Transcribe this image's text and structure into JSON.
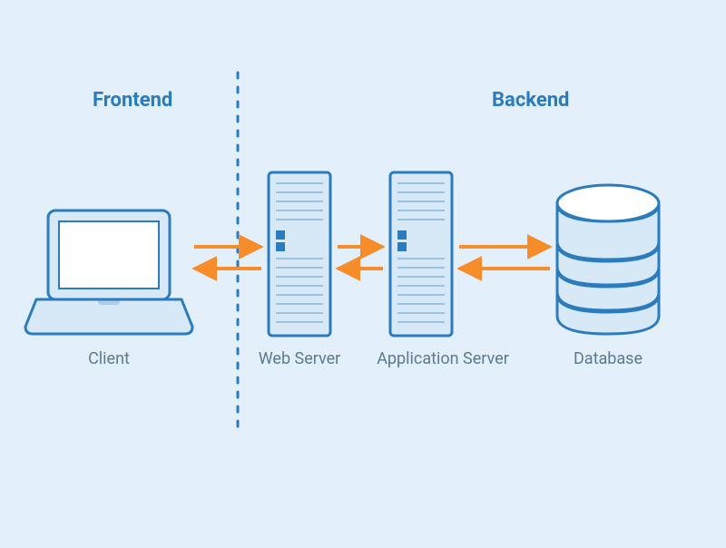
{
  "sections": {
    "frontend": "Frontend",
    "backend": "Backend"
  },
  "nodes": {
    "client": {
      "label": "Client"
    },
    "web": {
      "label": "Web Server"
    },
    "app": {
      "label": "Application Server"
    },
    "database": {
      "label": "Database"
    }
  },
  "colors": {
    "stroke": "#2b7bbf",
    "fill_light": "#d7e9f7",
    "fill_white": "#ffffff",
    "arrow": "#f78c2a",
    "label": "#5a7a92"
  },
  "connections": [
    {
      "from": "client",
      "to": "web",
      "bidirectional": true
    },
    {
      "from": "web",
      "to": "app",
      "bidirectional": true
    },
    {
      "from": "app",
      "to": "database",
      "bidirectional": true
    }
  ]
}
